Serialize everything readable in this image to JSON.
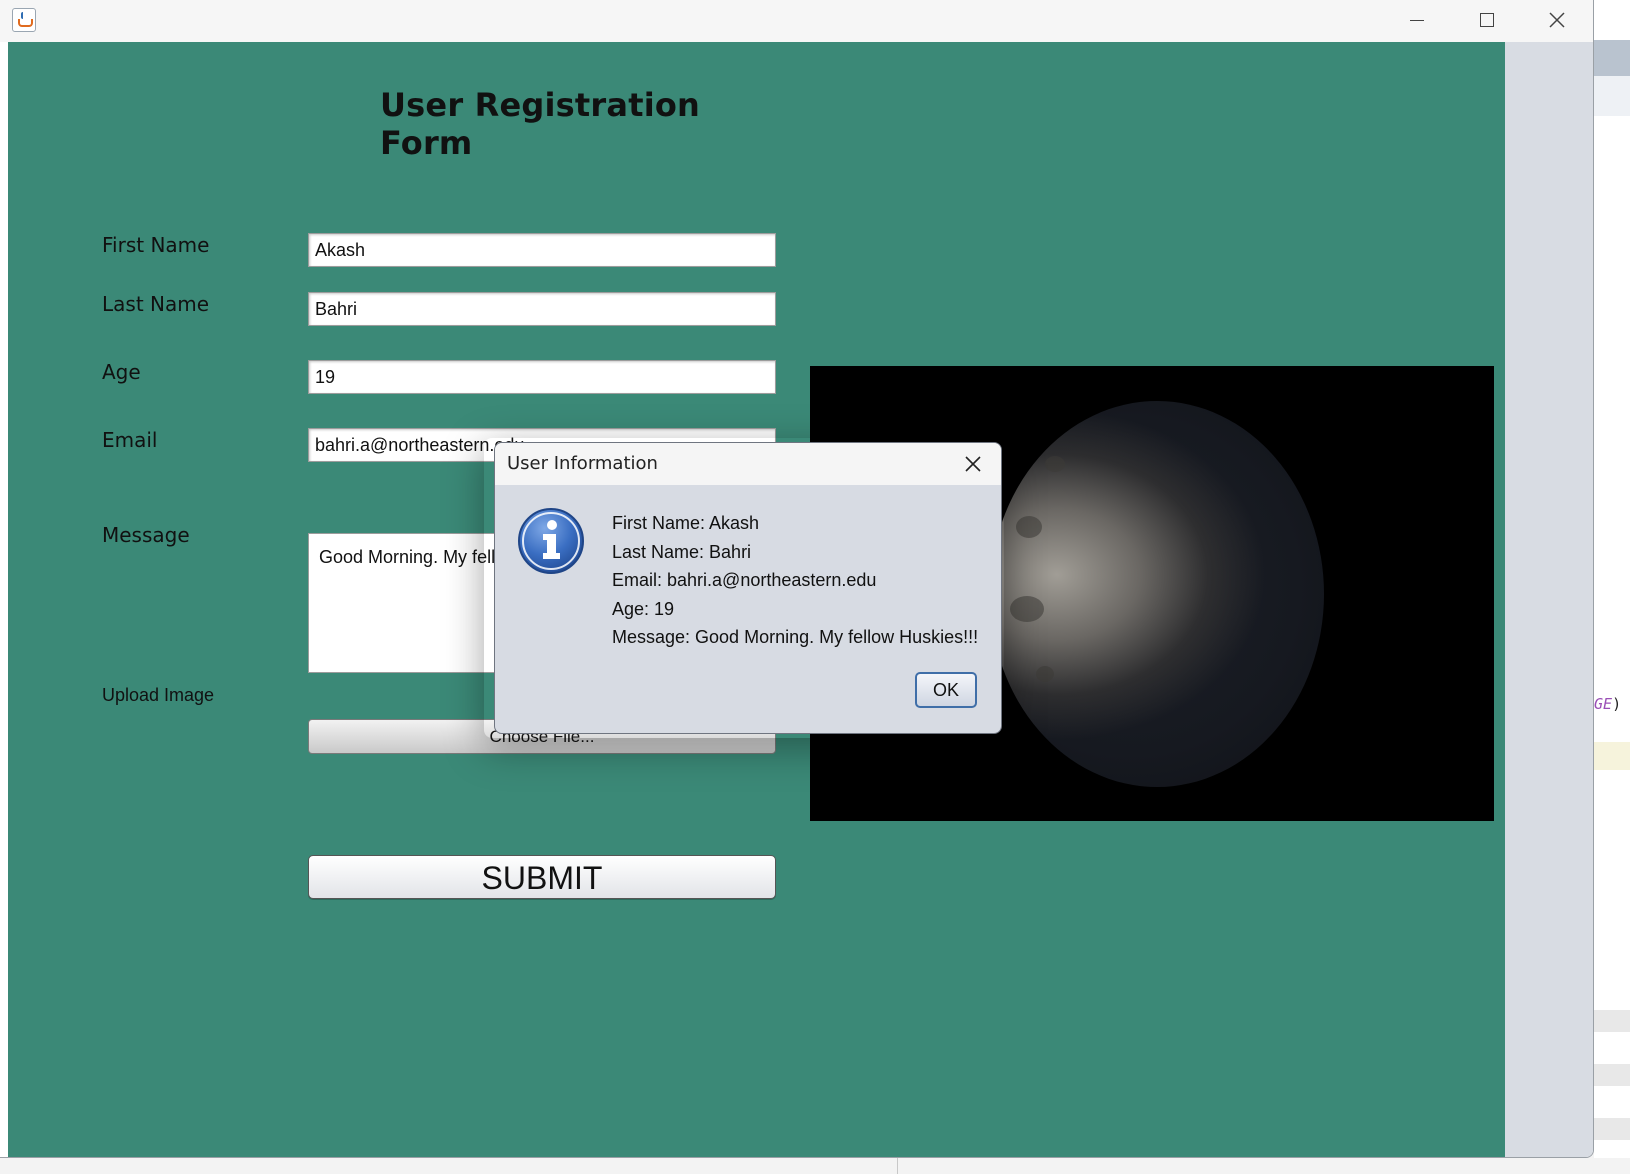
{
  "window": {
    "title": "",
    "controls": {
      "minimize": "minimize-icon",
      "maximize": "maximize-icon",
      "close": "close-icon"
    }
  },
  "form": {
    "title": "User Registration Form",
    "labels": {
      "first_name": "First Name",
      "last_name": "Last Name",
      "age": "Age",
      "email": "Email",
      "message": "Message",
      "upload_image": "Upload Image"
    },
    "values": {
      "first_name": "Akash",
      "last_name": "Bahri",
      "age": "19",
      "email": "bahri.a@northeastern.edu",
      "message": "Good Morning. My fellow Huskies!!!"
    },
    "choose_file_label": "Choose File...",
    "submit_label": "SUBMIT"
  },
  "dialog": {
    "title": "User Information",
    "icon": "info-icon",
    "lines": [
      "First Name: Akash",
      "Last Name: Bahri",
      "Email: bahri.a@northeastern.edu",
      "Age: 19",
      "Message: Good Morning. My fellow Huskies!!!"
    ],
    "ok_label": "OK"
  },
  "background_code_fragment": {
    "keyword": "GE",
    "suffix": ")"
  },
  "colors": {
    "form_background": "#3b8977",
    "dialog_background": "#d7dbe3",
    "ok_button_border": "#3f6ea8",
    "info_icon_blue": "#2f5fb0"
  }
}
